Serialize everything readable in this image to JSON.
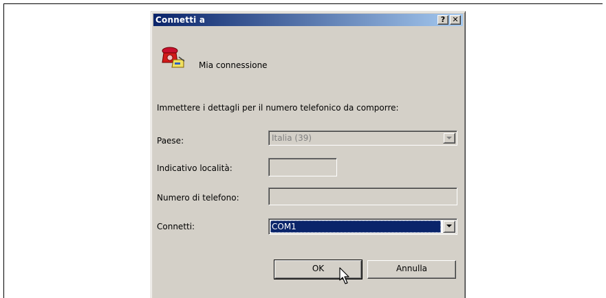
{
  "dialog": {
    "title": "Connetti a",
    "help_label": "?",
    "close_label": "✕",
    "connection_name": "Mia connessione",
    "instruction": "Immettere i dettagli per il numero telefonico da comporre:",
    "fields": {
      "country_label": "Paese:",
      "country_value": "Italia (39)",
      "area_code_label": "Indicativo località:",
      "area_code_value": "",
      "phone_label": "Numero di telefono:",
      "phone_value": "",
      "connect_label": "Connetti:",
      "connect_value": "COM1"
    },
    "buttons": {
      "ok_label": "OK",
      "cancel_label": "Annulla"
    }
  },
  "icons": {
    "connection": "telephone-icon",
    "cursor": "mouse-pointer-icon"
  },
  "colors": {
    "title_gradient_start": "#0a246a",
    "title_gradient_end": "#a6caf0",
    "face": "#d4d0c8",
    "selection": "#0a246a"
  }
}
